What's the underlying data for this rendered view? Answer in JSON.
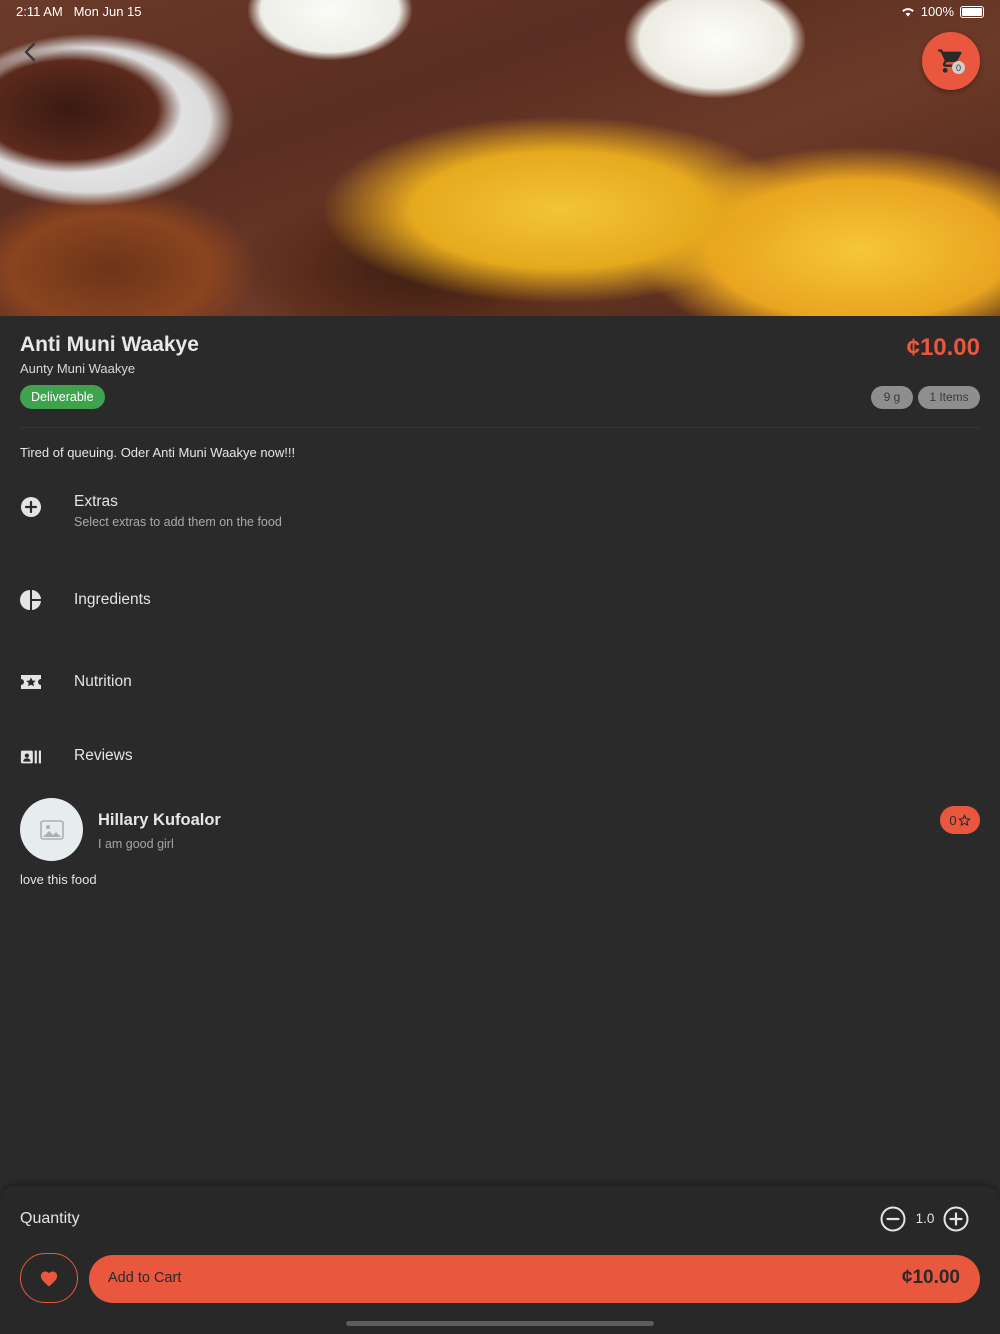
{
  "status_bar": {
    "time": "2:11 AM",
    "date": "Mon Jun 15",
    "battery": "100%"
  },
  "cart": {
    "count": "0"
  },
  "food": {
    "title": "Anti Muni Waakye",
    "restaurant": "Aunty Muni Waakye",
    "deliverable_label": "Deliverable",
    "price": "¢10.00",
    "weight": "9 g",
    "items": "1 Items",
    "description": "Tired of queuing. Oder Anti Muni Waakye now!!!"
  },
  "sections": {
    "extras": {
      "title": "Extras",
      "subtitle": "Select extras to add them on the food"
    },
    "ingredients": {
      "title": "Ingredients"
    },
    "nutrition": {
      "title": "Nutrition"
    },
    "reviews": {
      "title": "Reviews"
    }
  },
  "review": {
    "name": "Hillary Kufoalor",
    "bio": "I am good girl",
    "rating": "0",
    "text": "love this food"
  },
  "bottom": {
    "quantity_label": "Quantity",
    "quantity": "1.0",
    "add_to_cart_label": "Add to Cart",
    "total": "¢10.00"
  },
  "colors": {
    "accent": "#e9573f",
    "background": "#2a2a2a",
    "deliverable": "#3fa34d"
  },
  "icons": {
    "back": "chevron-left-icon",
    "cart": "shopping-cart-icon",
    "extras": "add-circle-icon",
    "ingredients": "pie-chart-icon",
    "nutrition": "ticket-star-icon",
    "reviews": "reviews-icon",
    "avatar": "image-placeholder-icon",
    "rating": "star-outline-icon",
    "minus": "minus-circle-icon",
    "plus": "plus-circle-icon",
    "favorite": "heart-icon"
  }
}
